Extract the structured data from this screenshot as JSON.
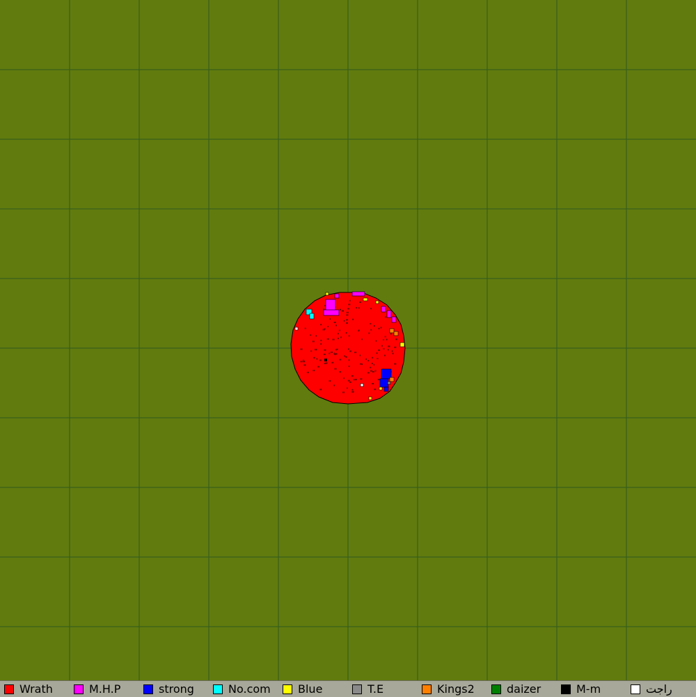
{
  "map": {
    "background_color": "#617b0e",
    "grid_color": "#2f5a1e",
    "grid_on": true
  },
  "legend": {
    "items": [
      {
        "label": "Wrath",
        "color": "#ff0000"
      },
      {
        "label": "M.H.P",
        "color": "#ff00ff"
      },
      {
        "label": "strong",
        "color": "#0000ff"
      },
      {
        "label": "No.com",
        "color": "#00ffff"
      },
      {
        "label": "Blue",
        "color": "#ffff00"
      },
      {
        "label": "T.E",
        "color": "#8a8a8a"
      },
      {
        "label": "Kings2",
        "color": "#ff8000"
      },
      {
        "label": "daizer",
        "color": "#007f00"
      },
      {
        "label": "M-m",
        "color": "#000000"
      },
      {
        "label": "راجت",
        "color": "#ffffff"
      }
    ]
  }
}
